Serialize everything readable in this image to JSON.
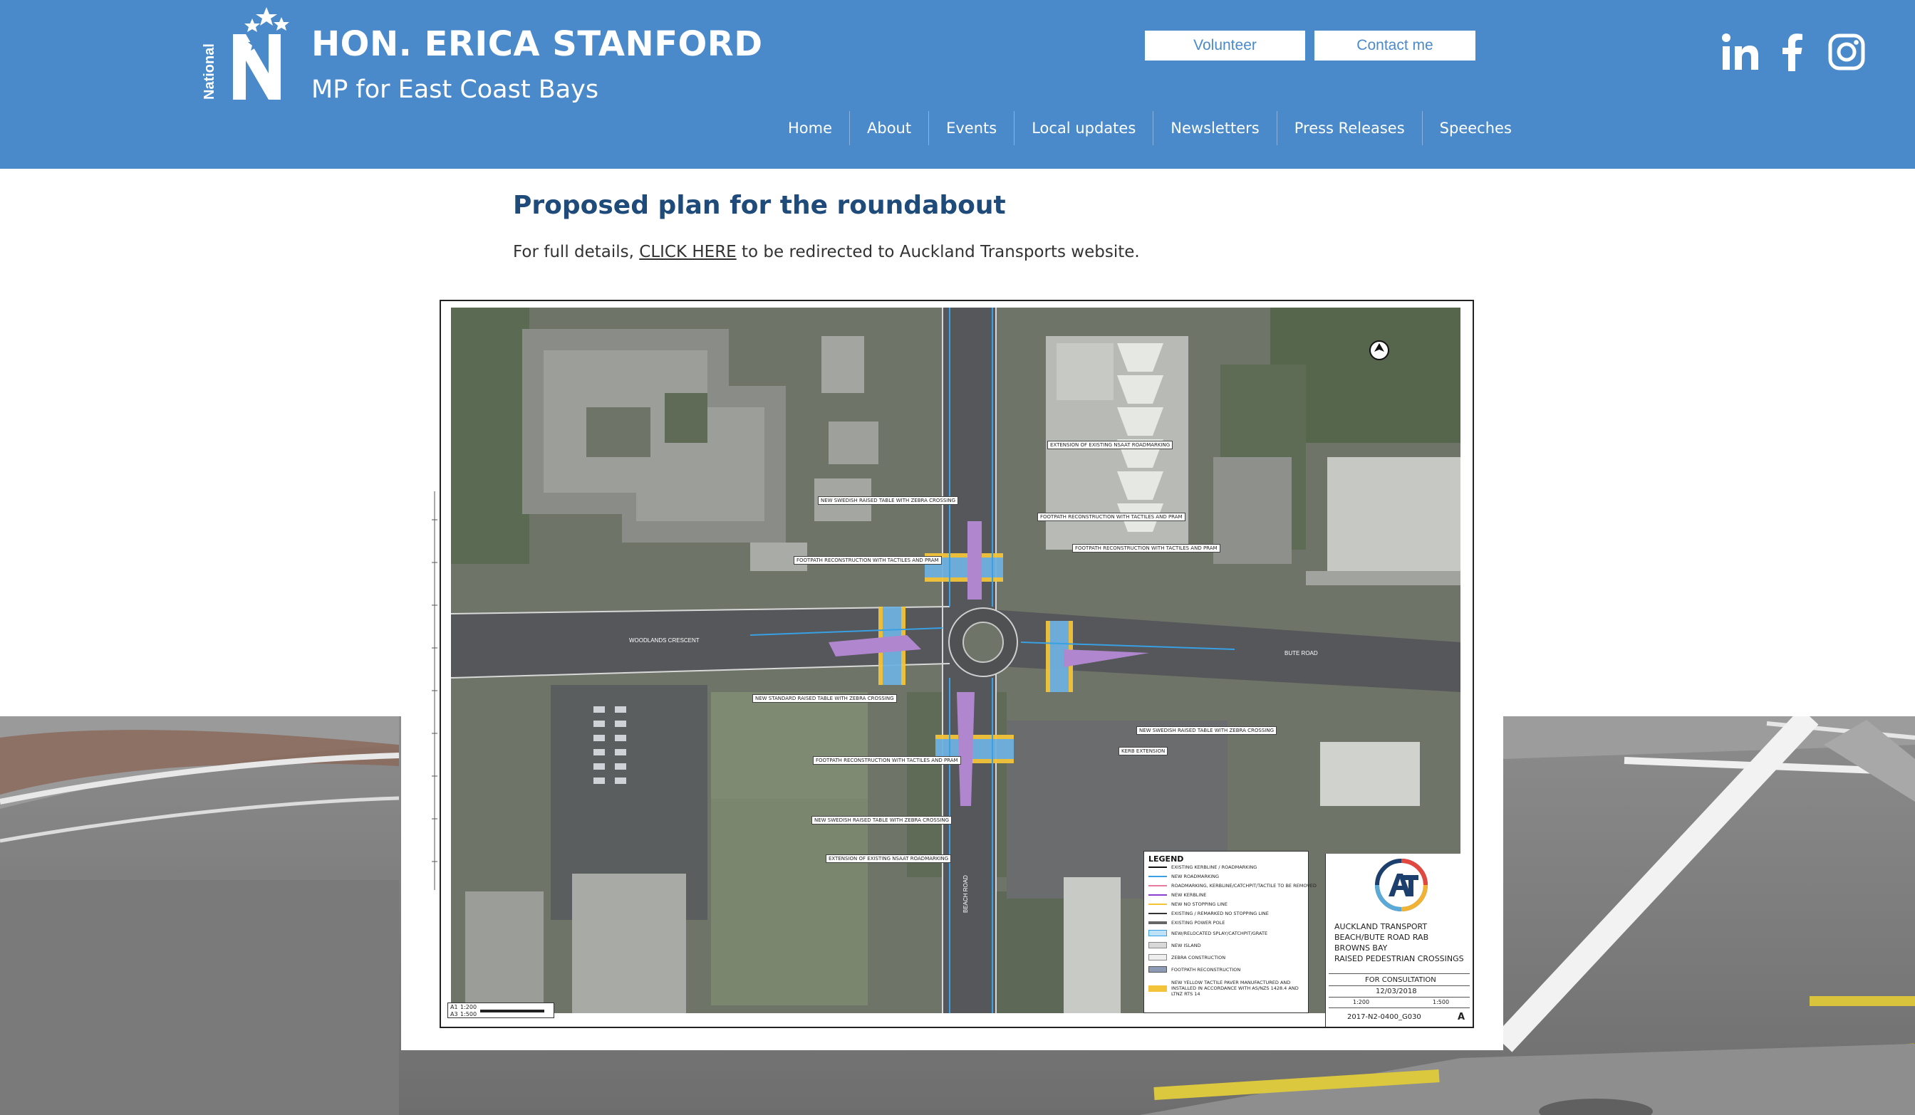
{
  "header": {
    "title": "HON. ERICA STANFORD",
    "subtitle": "MP for East Coast Bays",
    "logo_text": "National",
    "buttons": {
      "volunteer": "Volunteer",
      "contact": "Contact me"
    },
    "social": [
      "linkedin-icon",
      "facebook-icon",
      "instagram-icon"
    ],
    "nav": [
      "Home",
      "About",
      "Events",
      "Local updates",
      "Newsletters",
      "Press Releases",
      "Speeches"
    ],
    "colors": {
      "header_bg": "#4a8acb",
      "button_text": "#4a8acb"
    }
  },
  "main": {
    "heading": "Proposed plan for the roundabout",
    "text_before": "For full details, ",
    "link_text": "CLICK HERE",
    "text_after": " to be redirected to Auckland Transports website.",
    "heading_color": "#1f4b7a"
  },
  "plan": {
    "callouts": [
      "NEW SWEDISH RAISED TABLE WITH ZEBRA CROSSING",
      "FOOTPATH RECONSTRUCTION WITH TACTILES AND PRAM",
      "FOOTPATH RECONSTRUCTION WITH TACTILES AND PRAM",
      "EXTENSION OF EXISTING NSAAT ROADMARKING",
      "FOOTPATH RECONSTRUCTION WITH TACTILES AND PRAM",
      "NEW STANDARD RAISED TABLE WITH ZEBRA CROSSING",
      "FOOTPATH RECONSTRUCTION WITH TACTILES AND PRAM",
      "NEW SWEDISH RAISED TABLE WITH ZEBRA CROSSING",
      "EXTENSION OF EXISTING NSAAT ROADMARKING",
      "NEW SWEDISH RAISED TABLE WITH ZEBRA CROSSING",
      "KERB EXTENSION"
    ],
    "street_labels": [
      "WOODLANDS CRESCENT",
      "BUTE ROAD",
      "BEACH ROAD"
    ],
    "legend": {
      "title": "LEGEND",
      "items": [
        "EXISTING KERBLINE / ROADMARKING",
        "NEW ROADMARKING",
        "ROADMARKING, KERBLINE/CATCHPIT/TACTILE TO BE REMOVED",
        "NEW KERBLINE",
        "NEW NO STOPPING LINE",
        "EXISTING / REMARKED NO STOPPING LINE",
        "EXISTING POWER POLE",
        "NEW/RELOCATED SPLAY/CATCHPIT/GRATE",
        "NEW ISLAND",
        "ZEBRA CONSTRUCTION",
        "FOOTPATH RECONSTRUCTION",
        "NEW YELLOW TACTILE PAVER MANUFACTURED AND INSTALLED IN ACCORDANCE WITH AS/NZS 1428.4 AND LTNZ RTS 14"
      ]
    },
    "titleblock": {
      "lines": [
        "AUCKLAND TRANSPORT",
        "BEACH/BUTE ROAD RAB",
        "BROWNS BAY",
        "RAISED PEDESTRIAN CROSSINGS"
      ],
      "status": "FOR CONSULTATION",
      "date": "12/03/2018",
      "scale_a1": "1:200",
      "scale_a3": "1:500",
      "drawing_no": "2017-N2-0400_G030",
      "revision": "A"
    },
    "scalebar": {
      "a1": "A1",
      "a1_scale": "1:200",
      "a3": "A3",
      "a3_scale": "1:500"
    }
  }
}
